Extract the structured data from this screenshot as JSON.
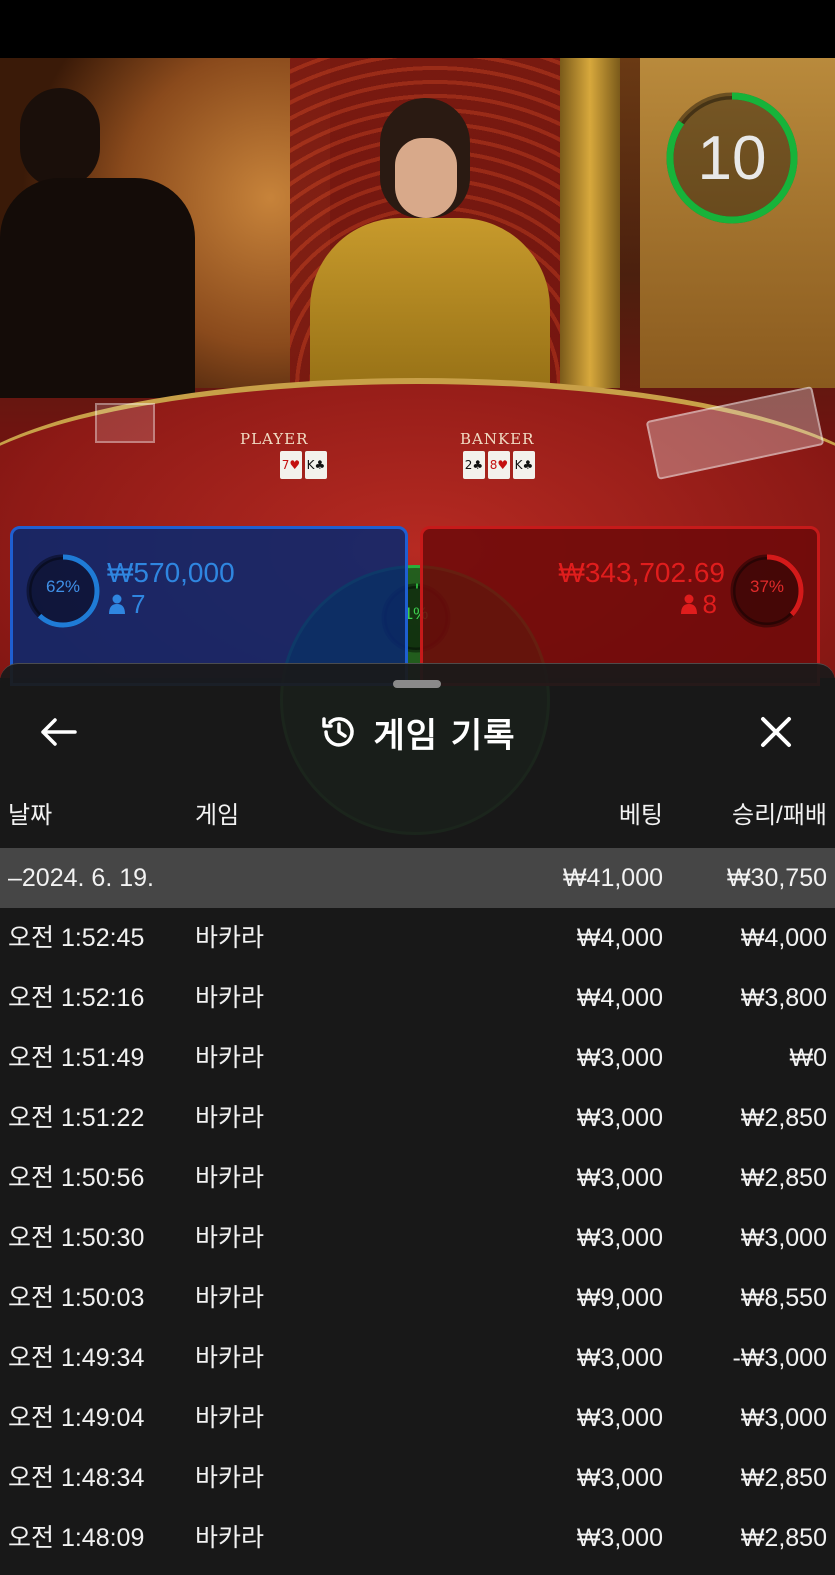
{
  "game_view": {
    "timer": "10",
    "table_labels": {
      "player": "PLAYER",
      "banker": "BANKER"
    },
    "player_cards": [
      {
        "rank": "7",
        "suit": "♥",
        "red": true
      },
      {
        "rank": "K",
        "suit": "♣",
        "red": false
      }
    ],
    "banker_cards": [
      {
        "rank": "2",
        "suit": "♣",
        "red": false
      },
      {
        "rank": "8",
        "suit": "♥",
        "red": true
      },
      {
        "rank": "K",
        "suit": "♣",
        "red": false
      }
    ],
    "player_bet": {
      "percent": "62%",
      "percent_value": 62,
      "amount": "₩570,000",
      "players": "7",
      "color": "#1f7bd6"
    },
    "banker_bet": {
      "percent": "37%",
      "percent_value": 37,
      "amount": "₩343,702.69",
      "players": "8",
      "color": "#d41a1a"
    },
    "tie_bet": {
      "percent": "1%",
      "percent_value": 1,
      "color": "#2ab03a"
    }
  },
  "sheet": {
    "title": "게임 기록",
    "back_icon": "arrow-left-icon",
    "close_icon": "close-icon",
    "history_icon": "history-icon",
    "columns": {
      "date": "날짜",
      "game": "게임",
      "bet": "베팅",
      "win_loss": "승리/패배"
    },
    "date_group": {
      "date": "–2024. 6. 19.",
      "bet": "₩41,000",
      "win_loss": "₩30,750"
    },
    "rows": [
      {
        "time": "오전 1:52:45",
        "game": "바카라",
        "bet": "₩4,000",
        "win_loss": "₩4,000"
      },
      {
        "time": "오전 1:52:16",
        "game": "바카라",
        "bet": "₩4,000",
        "win_loss": "₩3,800"
      },
      {
        "time": "오전 1:51:49",
        "game": "바카라",
        "bet": "₩3,000",
        "win_loss": "₩0"
      },
      {
        "time": "오전 1:51:22",
        "game": "바카라",
        "bet": "₩3,000",
        "win_loss": "₩2,850"
      },
      {
        "time": "오전 1:50:56",
        "game": "바카라",
        "bet": "₩3,000",
        "win_loss": "₩2,850"
      },
      {
        "time": "오전 1:50:30",
        "game": "바카라",
        "bet": "₩3,000",
        "win_loss": "₩3,000"
      },
      {
        "time": "오전 1:50:03",
        "game": "바카라",
        "bet": "₩9,000",
        "win_loss": "₩8,550"
      },
      {
        "time": "오전 1:49:34",
        "game": "바카라",
        "bet": "₩3,000",
        "win_loss": "-₩3,000"
      },
      {
        "time": "오전 1:49:04",
        "game": "바카라",
        "bet": "₩3,000",
        "win_loss": "₩3,000"
      },
      {
        "time": "오전 1:48:34",
        "game": "바카라",
        "bet": "₩3,000",
        "win_loss": "₩2,850"
      },
      {
        "time": "오전 1:48:09",
        "game": "바카라",
        "bet": "₩3,000",
        "win_loss": "₩2,850"
      }
    ]
  }
}
